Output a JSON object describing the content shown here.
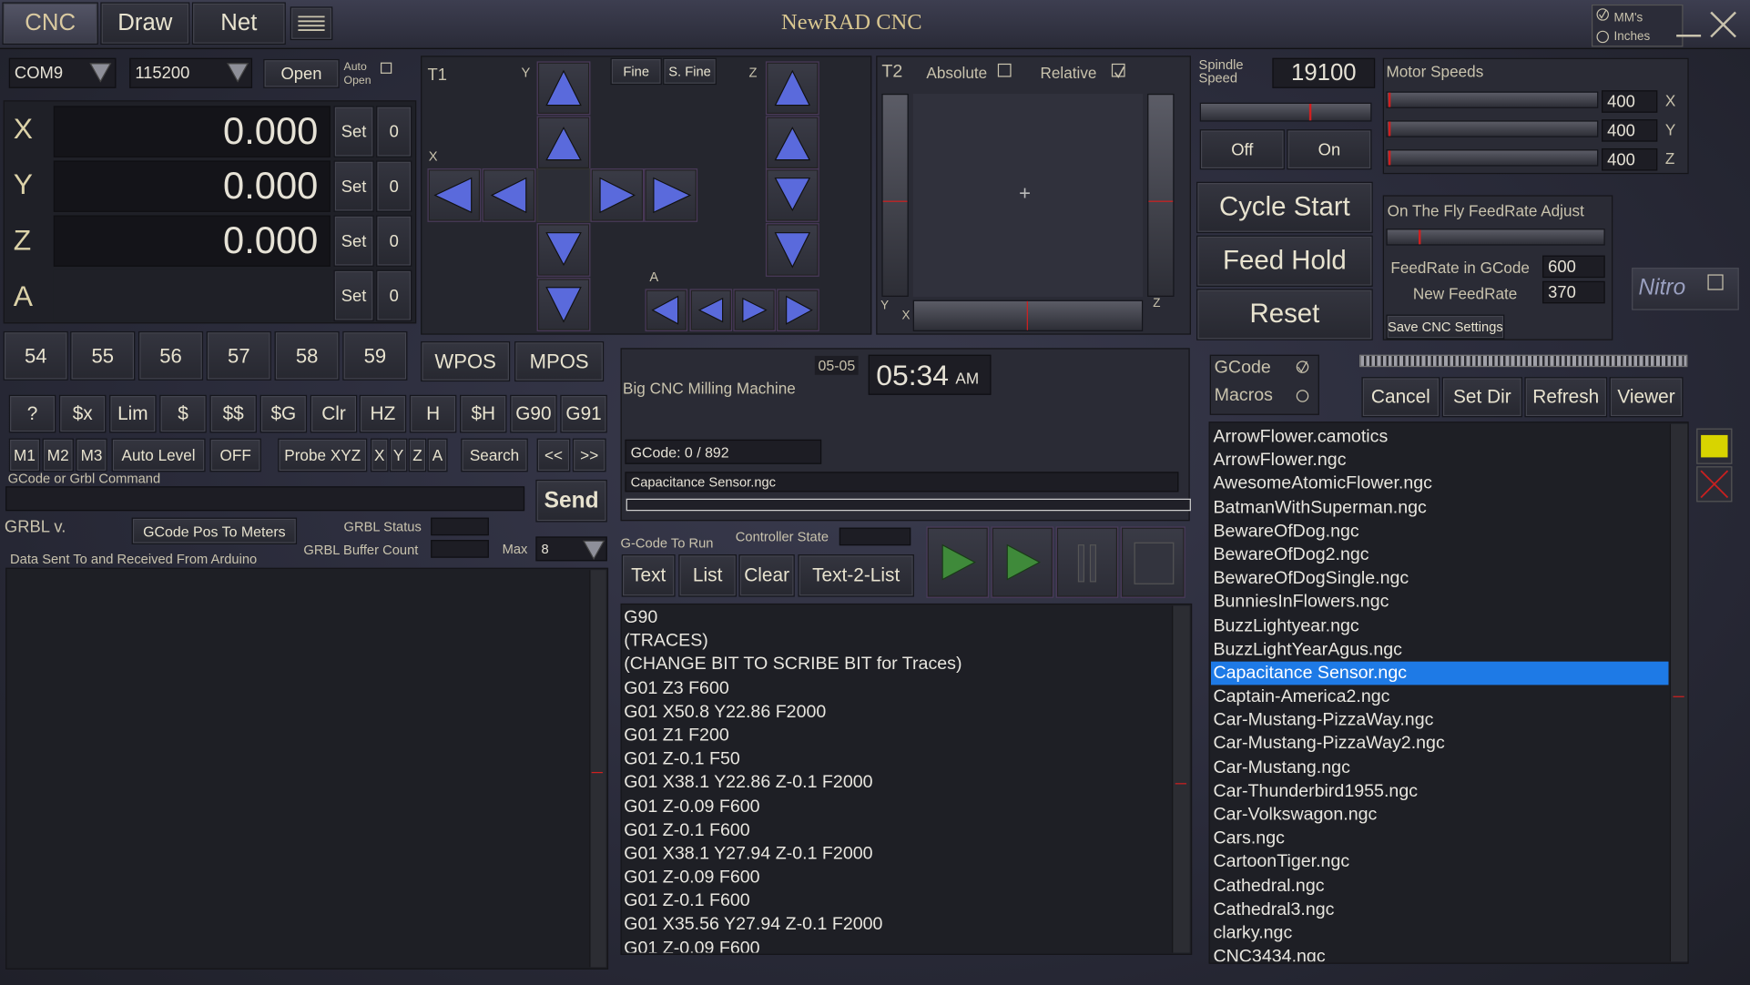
{
  "tabs": [
    "CNC",
    "Draw",
    "Net"
  ],
  "window_title": "NewRAD CNC",
  "units": {
    "mm_label": "MM's",
    "inches_label": "Inches"
  },
  "connection": {
    "port": "COM9",
    "baud": "115200",
    "open_label": "Open",
    "auto_open_label": "Auto Open"
  },
  "axes": [
    {
      "name": "X",
      "value": "0.000",
      "set_label": "Set",
      "zero_label": "0"
    },
    {
      "name": "Y",
      "value": "0.000",
      "set_label": "Set",
      "zero_label": "0"
    },
    {
      "name": "Z",
      "value": "0.000",
      "set_label": "Set",
      "zero_label": "0"
    },
    {
      "name": "A",
      "value": "",
      "set_label": "Set",
      "zero_label": "0"
    }
  ],
  "work_offsets": [
    "54",
    "55",
    "56",
    "57",
    "58",
    "59"
  ],
  "pos_buttons": [
    "WPOS",
    "MPOS"
  ],
  "grbl_buttons": [
    "?",
    "$x",
    "Lim",
    "$",
    "$$",
    "$G",
    "Clr",
    "HZ",
    "H",
    "$H",
    "G90",
    "G91"
  ],
  "row2_buttons": {
    "m1": "M1",
    "m2": "M2",
    "m3": "M3",
    "auto_level": "Auto Level",
    "off": "OFF",
    "probe_xyz": "Probe XYZ",
    "x": "X",
    "y": "Y",
    "z": "Z",
    "a": "A",
    "search": "Search",
    "prev": "<<",
    "next": ">>"
  },
  "command": {
    "label": "GCode or Grbl Command",
    "send_label": "Send"
  },
  "grbl_info": {
    "version_label": "GRBL v.",
    "pos_meters_label": "GCode Pos To Meters",
    "status_label": "GRBL Status",
    "buffer_label": "GRBL Buffer Count",
    "max_label": "Max",
    "max_value": "8",
    "data_label": "Data Sent To and Received From Arduino"
  },
  "jog": {
    "t1_label": "T1",
    "y_label": "Y",
    "x_label": "X",
    "z_label": "Z",
    "a_label": "A",
    "fine_label": "Fine",
    "sfine_label": "S. Fine"
  },
  "t2": {
    "label": "T2",
    "absolute_label": "Absolute",
    "relative_label": "Relative",
    "y_label": "Y",
    "x_label": "X",
    "z_label": "Z"
  },
  "spindle": {
    "label": "Spindle Speed",
    "value": "19100",
    "off_label": "Off",
    "on_label": "On"
  },
  "motor_speeds": {
    "label": "Motor Speeds",
    "items": [
      {
        "value": "400",
        "axis": "X"
      },
      {
        "value": "400",
        "axis": "Y"
      },
      {
        "value": "400",
        "axis": "Z"
      }
    ]
  },
  "cycle": {
    "start": "Cycle Start",
    "hold": "Feed Hold",
    "reset": "Reset"
  },
  "feedrate": {
    "label": "On The Fly FeedRate Adjust",
    "gcode_label": "FeedRate in GCode",
    "gcode_value": "600",
    "new_label": "New FeedRate",
    "new_value": "370",
    "save_label": "Save CNC Settings",
    "nitro_label": "Nitro"
  },
  "machine": {
    "name": "Big CNC Milling Machine",
    "date": "05-05",
    "time": "05:34",
    "ampm": "AM"
  },
  "gcode_progress": {
    "text": "GCode: 0 / 892",
    "file": "Capacitance Sensor.ngc"
  },
  "run": {
    "label": "G-Code To Run",
    "controller_label": "Controller State",
    "text_label": "Text",
    "list_label": "List",
    "clear_label": "Clear",
    "t2l_label": "Text-2-List"
  },
  "gcode_lines": [
    "G90",
    "(TRACES)",
    "(CHANGE BIT TO SCRIBE BIT for Traces)",
    "G01 Z3 F600",
    "G01 X50.8 Y22.86 F2000",
    "G01 Z1 F200",
    "G01 Z-0.1 F50",
    "G01 X38.1 Y22.86 Z-0.1 F2000",
    "G01 Z-0.09 F600",
    "G01 Z-0.1 F600",
    "G01 X38.1 Y27.94 Z-0.1 F2000",
    "G01 Z-0.09 F600",
    "G01 Z-0.1 F600",
    "G01 X35.56 Y27.94 Z-0.1 F2000",
    "G01 Z-0.09 F600"
  ],
  "files": {
    "gcode_label": "GCode",
    "macros_label": "Macros",
    "cancel_label": "Cancel",
    "setdir_label": "Set Dir",
    "refresh_label": "Refresh",
    "viewer_label": "Viewer",
    "selected": "Capacitance Sensor.ngc",
    "items": [
      "ArrowFlower.camotics",
      "ArrowFlower.ngc",
      "AwesomeAtomicFlower.ngc",
      "BatmanWithSuperman.ngc",
      "BewareOfDog.ngc",
      "BewareOfDog2.ngc",
      "BewareOfDogSingle.ngc",
      "BunniesInFlowers.ngc",
      "BuzzLightyear.ngc",
      "BuzzLightYearAgus.ngc",
      "Capacitance Sensor.ngc",
      "Captain-America2.ngc",
      "Car-Mustang-PizzaWay.ngc",
      "Car-Mustang-PizzaWay2.ngc",
      "Car-Mustang.ngc",
      "Car-Thunderbird1955.ngc",
      "Car-Volkswagon.ngc",
      "Cars.ngc",
      "CartoonTiger.ngc",
      "Cathedral.ngc",
      "Cathedral3.ngc",
      "clarky.ngc",
      "CNC3434.ngc"
    ]
  },
  "colors": {
    "accent_red": "#d02020",
    "selected_blue": "#1e7ae6",
    "folder_yellow": "#d8d400",
    "play_green": "#3f8a3a"
  }
}
